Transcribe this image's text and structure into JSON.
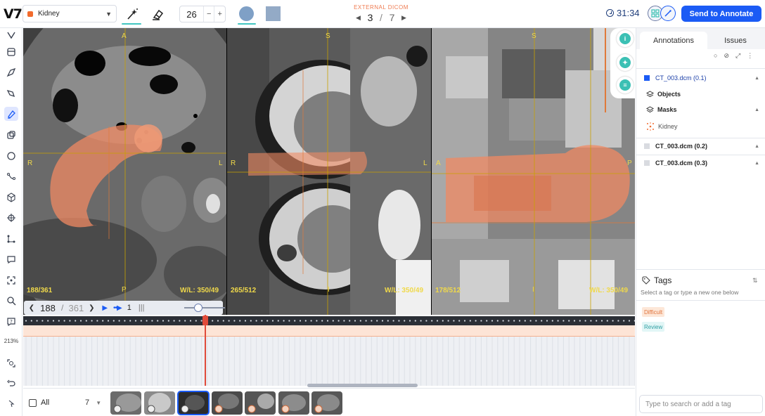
{
  "app": {
    "logo": "V7"
  },
  "toolbar": {
    "class_label": "Kidney",
    "class_color": "#f26b2d",
    "brush_size": "26",
    "brush_minus": "−",
    "brush_plus": "+",
    "source_label": "EXTERNAL DICOM",
    "page_current": "3",
    "page_sep": "/",
    "page_total": "7",
    "timer": "31:34",
    "send_label": "Send to Annotate",
    "accent": "#1b5bf5"
  },
  "left_tools": {
    "zoom": "213%"
  },
  "viewports": [
    {
      "top": "A",
      "left": "R",
      "right": "L",
      "bottom": "P",
      "slice": "188/361",
      "wl": "W/L: 350/49"
    },
    {
      "top": "S",
      "left": "R",
      "right": "L",
      "bottom": "I",
      "slice": "265/512",
      "wl": "W/L: 350/49"
    },
    {
      "top": "S",
      "left": "A",
      "right": "P",
      "bottom": "I",
      "slice": "178/512",
      "wl": "W/L: 350/49"
    }
  ],
  "playback": {
    "current": "188",
    "sep": "/",
    "total": "361",
    "fps": "1"
  },
  "bottom": {
    "filter": "All",
    "count": "7"
  },
  "panel": {
    "tabs": [
      {
        "label": "Annotations"
      },
      {
        "label": "Issues"
      }
    ],
    "items": [
      {
        "label": "CT_003.dcm (0.1)"
      },
      {
        "label": "Objects"
      },
      {
        "label": "Masks"
      },
      {
        "label": "Kidney"
      },
      {
        "label": "CT_003.dcm (0.2)"
      },
      {
        "label": "CT_003.dcm (0.3)"
      }
    ],
    "tags_title": "Tags",
    "tags_hint": "Select a tag or type a new one below",
    "tags": [
      {
        "label": "Difficult"
      },
      {
        "label": "Review"
      }
    ],
    "tag_input_placeholder": "Type to search or add a tag"
  }
}
